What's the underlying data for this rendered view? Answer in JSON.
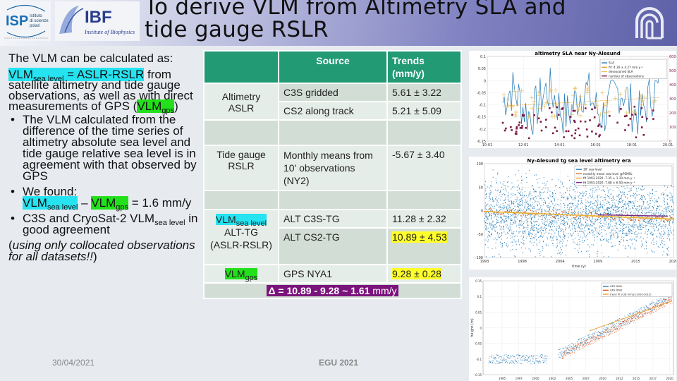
{
  "header": {
    "title": "To derive VLM from Altimetry SLA and tide gauge RSLR",
    "logos": [
      "isp-logo",
      "ibf-logo",
      "cnr-logo"
    ],
    "isp_logo_text": [
      "Istituto",
      "di scienze",
      "polari"
    ],
    "ibf_logo_text": "IBF",
    "ibf_logo_subtitle": "Institute of Biophysics"
  },
  "left_panel": {
    "intro": "The VLM can be calculated as:",
    "formula_vlm": "VLM",
    "formula_sub": "sea level",
    "formula_rest": " = ASLR-RSLR",
    "formula_tail": " from satellite altimetry and tide gauge observations, as well as with direct measurements of GPS (",
    "gps_vlm": "VLM",
    "gps_sub": "gps",
    "gps_close": ")",
    "bullet1": "The VLM calculated from the difference of the time series of altimetry absolute sea level and tide gauge relative sea level is in agreement with that observed by GPS",
    "bullet2_lead": "We found:",
    "bullet2_vlm1": "VLM",
    "bullet2_sub1": "sea level",
    "bullet2_minus": " – ",
    "bullet2_vlm2": "VLM",
    "bullet2_sub2": "gps",
    "bullet2_value": " = 1.6 mm/y",
    "bullet3_a": "C3S and CryoSat-2 VLM",
    "bullet3_sub": "sea level",
    "bullet3_b": " in good agreement",
    "note_open": "(",
    "note_italic": "using only collocated observations for all datasets!!",
    "note_close": ")"
  },
  "table": {
    "headers": [
      "",
      "Source",
      "Trends (mm/y)"
    ],
    "rows": [
      {
        "group": "Altimetry ASLR",
        "source": "C3S gridded",
        "trend": "5.61 ± 3.22"
      },
      {
        "group": "",
        "source": "CS2 along track",
        "trend": "5.21 ± 5.09"
      },
      {
        "group": "",
        "source": "",
        "trend": ""
      },
      {
        "group": "Tide gauge RSLR",
        "source": "Monthly means from 10' observations (NY2)",
        "trend": "-5.67 ± 3.40"
      },
      {
        "group": "",
        "source": "",
        "trend": ""
      },
      {
        "group_vlm": "VLM",
        "group_sub": "sea level",
        "group_rest": "ALT-TG (ASLR-RSLR)",
        "source": "ALT C3S-TG",
        "trend": "11.28 ± 2.32"
      },
      {
        "group": "",
        "source": "ALT CS2-TG",
        "trend": "10.89 ± 4.53"
      },
      {
        "group_vlm": "VLM",
        "group_sub": "gps",
        "source": "GPS NYA1",
        "trend": "9.28 ± 0.28"
      }
    ],
    "delta_prefix": "Δ = 10.89 - 9.28  ~ ",
    "delta_bold": "1.61",
    "delta_unit": " mm/y"
  },
  "chart_data": [
    {
      "type": "line",
      "title": "altimetry SLA near Ny-Alesund",
      "xlabel": "",
      "ylabel": "",
      "x_ticks": [
        "10-01",
        "12-01",
        "14-01",
        "16-01",
        "18-01",
        "20-01"
      ],
      "y_ticks": [
        "0.1",
        "0.05",
        "0",
        "-0.05",
        "-0.1",
        "-0.15",
        "-0.2",
        "-0.25"
      ],
      "ylim": [
        -0.25,
        0.1
      ],
      "y2_ticks": [
        "6000",
        "5000",
        "4000",
        "3000",
        "2000",
        "1000",
        "0"
      ],
      "y2lim": [
        0,
        6000
      ],
      "legend": [
        "SLA",
        "fit: 4.30 ± 4.27 mm y⁻¹",
        "deseasoned SLA",
        "number of observations"
      ],
      "legend_position": "top-right",
      "colors": {
        "sla": "#1f77b4",
        "fit": "#e8a030",
        "deseasoned": "#e8c060",
        "obs": "#7a1845"
      }
    },
    {
      "type": "scatter",
      "title": "Ny-Alesund tg sea level altimetry era",
      "xlabel": "time (y)",
      "ylabel": "",
      "x_ticks": [
        "1993",
        "1998",
        "2004",
        "2009",
        "2015",
        "2020"
      ],
      "y_ticks": [
        "100",
        "50",
        "0",
        "-50",
        "-100"
      ],
      "ylim": [
        -100,
        120
      ],
      "legend": [
        "10' sea level",
        "monthly mean sea level @PSMSL",
        "fit 1993-2020 -7.35 ± 1.10 mm y⁻¹",
        "fit 1993-2020 -7.88 ± 6.50 mm y⁻¹"
      ],
      "legend_position": "top-right",
      "fit_start": 8,
      "fit_end": -10,
      "colors": {
        "raw": "#1f77b4",
        "monthly": "#e06a20",
        "fit1": "#e8b030",
        "fit2": "#7a2a80"
      }
    },
    {
      "type": "line",
      "title": "",
      "xlabel": "time (y)",
      "ylabel": "height (m)",
      "x_ticks": [
        "1995",
        "1997",
        "2000",
        "2002",
        "2005",
        "2007",
        "2010",
        "2012",
        "2015",
        "2017",
        "2020"
      ],
      "y_ticks": [
        "0.15",
        "0.1",
        "0.05",
        "0",
        "-0.05",
        "-0.1",
        "-0.15"
      ],
      "ylim": [
        -0.15,
        0.15
      ],
      "legend": [
        "GPS NYAL",
        "GPS NYA1",
        "trend fit 9.28 mm/y (2010-2015)"
      ],
      "legend_position": "top-right",
      "colors": {
        "nyal": "#1f77b4",
        "nya1": "#e05a20",
        "fit": "#e8a030"
      }
    }
  ],
  "footer": {
    "date": "30/04/2021",
    "conference": "EGU 2021"
  }
}
